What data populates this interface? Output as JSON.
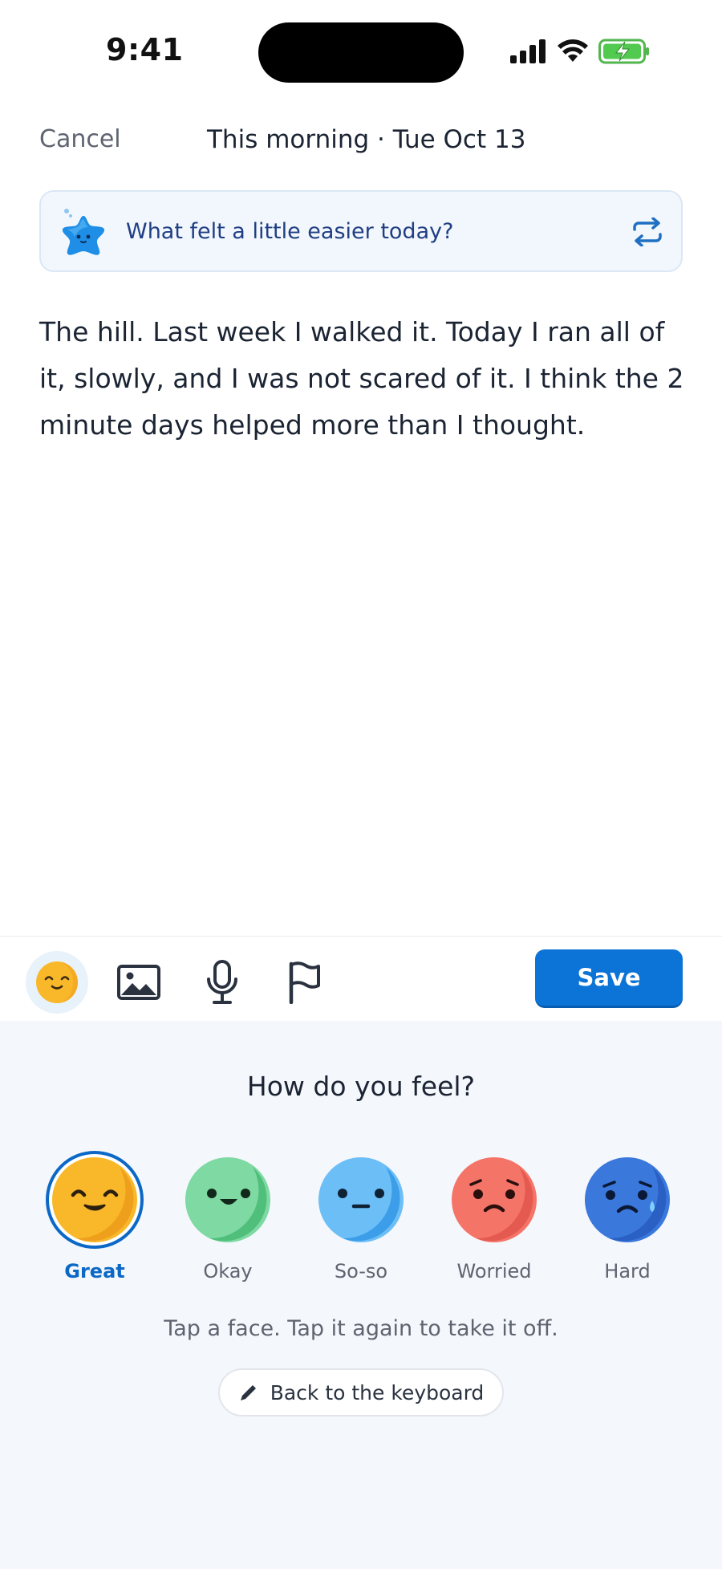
{
  "status_bar": {
    "time": "9:41"
  },
  "nav": {
    "cancel_label": "Cancel",
    "title": "This morning · Tue Oct 13"
  },
  "prompt": {
    "text": "What felt a little easier today?",
    "icon": "star-mascot-icon",
    "action_icon": "shuffle-icon"
  },
  "entry": {
    "text": "The hill. Last week I walked it. Today I ran all of it, slowly, and I was not scared of it. I think the 2 minute days helped more than I thought."
  },
  "toolbar": {
    "tools": [
      "mood-icon",
      "photo-icon",
      "microphone-icon",
      "flag-icon"
    ],
    "save_label": "Save"
  },
  "mood_sheet": {
    "heading": "How do you feel?",
    "options": [
      {
        "label": "Great",
        "color": "#f9b82a",
        "selected": true
      },
      {
        "label": "Okay",
        "color": "#6fd39a",
        "selected": false
      },
      {
        "label": "So-so",
        "color": "#5db4f5",
        "selected": false
      },
      {
        "label": "Worried",
        "color": "#f36e64",
        "selected": false
      },
      {
        "label": "Hard",
        "color": "#2f6fd6",
        "selected": false
      }
    ],
    "hint": "Tap a face. Tap it again to take it off.",
    "keyboard_button_label": "Back to the keyboard"
  },
  "colors": {
    "accent": "#0b74d6",
    "sheet_bg": "#f4f7fb"
  }
}
